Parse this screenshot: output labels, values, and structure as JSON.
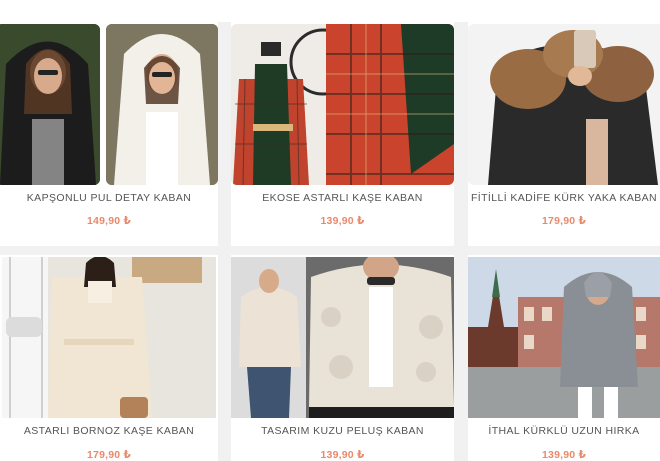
{
  "products": [
    {
      "name": "KAPŞONLU PUL DETAY KABAN",
      "price": "149,90 ₺"
    },
    {
      "name": "EKOSE ASTARLI KAŞE KABAN",
      "price": "139,90 ₺"
    },
    {
      "name": "FİTİLLİ KADİFE KÜRK YAKA KABAN",
      "price": "179,90 ₺"
    },
    {
      "name": "ASTARLI BORNOZ KAŞE KABAN",
      "price": "179,90 ₺"
    },
    {
      "name": "TASARIM KUZU PELUŞ KABAN",
      "price": "139,90 ₺"
    },
    {
      "name": "İTHAL KÜRKLÜ UZUN HIRKA",
      "price": "139,90 ₺"
    }
  ],
  "colors": {
    "price": "#e8896b",
    "title": "#555555",
    "background": "#f1f1f1"
  }
}
